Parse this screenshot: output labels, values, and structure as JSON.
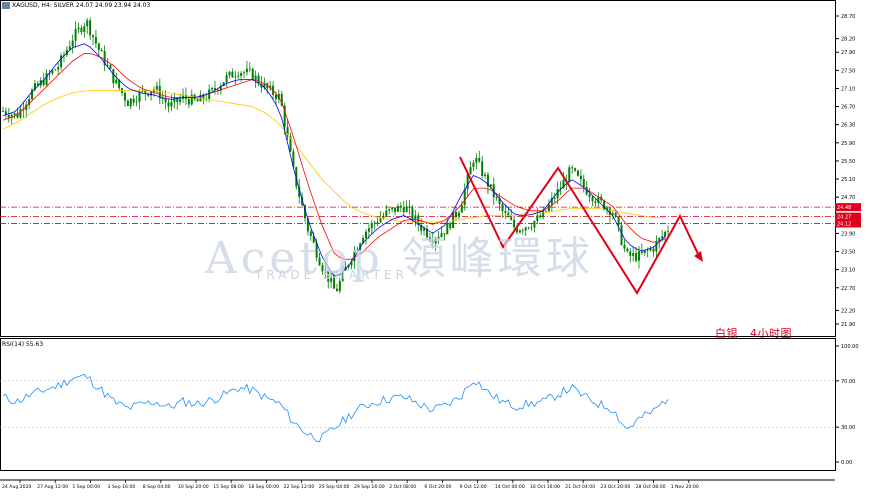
{
  "header": {
    "symbol_line": "XAGUSD, H4:  SILVER  24.07 24.09 23.94 24.03"
  },
  "rsi": {
    "label": "RSI(14) 55.63",
    "levels": [
      "100.00",
      "70.00",
      "30.00",
      "0.00"
    ]
  },
  "annotation": "白银   4小时图",
  "watermark": {
    "main": "Acetop 領峰環球",
    "sub": "TRADE SMARTER"
  },
  "colors": {
    "candle": "#008000",
    "ma_fast": "#0000ff",
    "ma_mid": "#ff0000",
    "ma_slow": "#ffc800",
    "rsi": "#1e90ff",
    "pattern": "#e0001a",
    "level_line": "#e0001a",
    "grid": "#c0c0c0"
  },
  "chart_data": [
    {
      "type": "candlestick",
      "title": "XAGUSD, H4: SILVER",
      "y_ticks": [
        "28.70",
        "28.20",
        "27.90",
        "27.50",
        "27.10",
        "26.70",
        "26.30",
        "25.90",
        "25.50",
        "25.10",
        "24.70",
        "24.30",
        "23.90",
        "23.50",
        "23.10",
        "22.70",
        "22.20",
        "21.90"
      ],
      "x_ticks": [
        "24 Aug 2020",
        "27 Aug 12:00",
        "1 Sep 00:00",
        "3 Sep 16:00",
        "8 Sep 04:00",
        "10 Sep 20:00",
        "15 Sep 08:00",
        "18 Sep 00:00",
        "22 Sep 12:00",
        "25 Sep 04:00",
        "29 Sep 16:00",
        "2 Oct 08:00",
        "6 Oct 20:00",
        "9 Oct 12:00",
        "14 Oct 00:00",
        "16 Oct 16:00",
        "21 Oct 04:00",
        "23 Oct 20:00",
        "28 Oct 08:00",
        "1 Nov 20:00"
      ],
      "price_levels": [
        {
          "price": 24.48,
          "label": "24.48"
        },
        {
          "price": 24.27,
          "label": "24.27"
        },
        {
          "price": 24.12,
          "label": "24.12"
        }
      ],
      "close_path": [
        26.6,
        26.5,
        27.0,
        27.3,
        27.6,
        28.2,
        28.6,
        27.9,
        27.3,
        26.8,
        27.0,
        27.1,
        26.7,
        26.9,
        26.8,
        27.0,
        27.3,
        27.5,
        27.4,
        27.1,
        26.9,
        25.2,
        24.0,
        23.2,
        22.6,
        23.3,
        23.9,
        24.2,
        24.4,
        24.5,
        24.1,
        23.8,
        24.0,
        24.5,
        25.6,
        25.0,
        24.4,
        24.0,
        24.1,
        24.3,
        24.8,
        25.3,
        24.9,
        24.6,
        24.4,
        23.4,
        23.4,
        23.6,
        24.0
      ],
      "ma_fast": [
        26.5,
        26.6,
        27.0,
        27.3,
        27.7,
        28.0,
        28.1,
        27.8,
        27.4,
        27.1,
        27.0,
        26.95,
        26.85,
        26.9,
        26.9,
        27.0,
        27.2,
        27.3,
        27.3,
        27.1,
        26.6,
        25.3,
        24.2,
        23.4,
        22.9,
        23.2,
        23.7,
        24.0,
        24.2,
        24.3,
        24.1,
        23.9,
        24.1,
        24.7,
        25.2,
        25.0,
        24.6,
        24.3,
        24.3,
        24.4,
        24.8,
        25.1,
        24.9,
        24.6,
        24.3,
        23.7,
        23.5,
        23.6,
        23.9
      ],
      "ma_mid": [
        26.4,
        26.5,
        26.8,
        27.1,
        27.4,
        27.7,
        27.9,
        27.8,
        27.6,
        27.3,
        27.1,
        27.0,
        26.9,
        26.9,
        26.9,
        27.0,
        27.1,
        27.2,
        27.3,
        27.2,
        26.9,
        26.0,
        25.0,
        24.1,
        23.4,
        23.3,
        23.5,
        23.8,
        24.0,
        24.2,
        24.2,
        24.1,
        24.2,
        24.5,
        24.9,
        24.9,
        24.7,
        24.5,
        24.4,
        24.4,
        24.6,
        24.9,
        24.9,
        24.7,
        24.5,
        24.1,
        23.8,
        23.7,
        23.8
      ],
      "ma_slow": [
        26.2,
        26.35,
        26.55,
        26.75,
        26.9,
        27.0,
        27.05,
        27.05,
        27.05,
        27.05,
        27.05,
        27.05,
        27.0,
        26.95,
        26.9,
        26.85,
        26.8,
        26.75,
        26.7,
        26.55,
        26.3,
        25.9,
        25.5,
        25.1,
        24.8,
        24.5,
        24.35,
        24.25,
        24.2,
        24.15,
        24.15,
        24.15,
        24.15,
        24.2,
        24.25,
        24.3,
        24.3,
        24.3,
        24.35,
        24.35,
        24.4,
        24.45,
        24.45,
        24.45,
        24.4,
        24.35,
        24.3,
        24.25,
        24.25
      ]
    },
    {
      "type": "line",
      "title": "RSI(14) 55.63",
      "ylim": [
        0,
        100
      ],
      "y_ticks": [
        "100.00",
        "70.00",
        "30.00",
        "0.00"
      ],
      "values": [
        56,
        52,
        58,
        62,
        66,
        72,
        74,
        63,
        52,
        46,
        50,
        52,
        47,
        52,
        50,
        53,
        58,
        64,
        62,
        55,
        50,
        34,
        24,
        20,
        30,
        40,
        48,
        52,
        55,
        56,
        50,
        45,
        49,
        56,
        72,
        60,
        52,
        48,
        50,
        52,
        58,
        64,
        56,
        50,
        46,
        28,
        38,
        44,
        56
      ]
    }
  ]
}
